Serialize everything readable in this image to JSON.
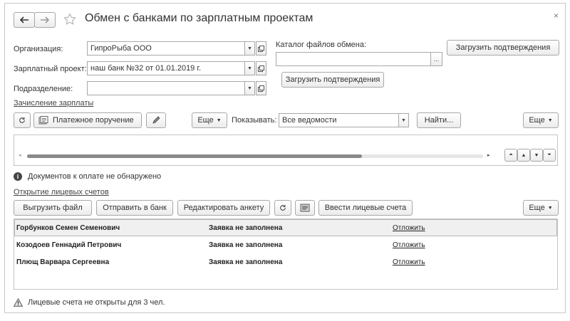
{
  "window": {
    "title": "Обмен с банками по зарплатным проектам",
    "close_glyph": "×"
  },
  "form": {
    "org_label": "Организация:",
    "org_value": "ГипроРыба ООО",
    "project_label": "Зарплатный проект:",
    "project_value": "наш банк №32 от 01.01.2019 г.",
    "division_label": "Подразделение:",
    "division_value": "",
    "catalog_label": "Каталог файлов обмена:",
    "catalog_value": "",
    "catalog_browse": "...",
    "load_confirm_top": "Загрузить подтверждения",
    "load_confirm_mid": "Загрузить подтверждения"
  },
  "salary": {
    "section_link": "Зачисление зарплаты",
    "payment_order_button": "Платежное поручение",
    "more_button": "Еще",
    "show_label": "Показывать:",
    "show_value": "Все ведомости",
    "find_button": "Найти...",
    "more_button_right": "Еще",
    "info_text": "Документов к оплате не обнаружено"
  },
  "accounts": {
    "section_link": "Открытие лицевых счетов",
    "export_button": "Выгрузить файл",
    "send_button": "Отправить в банк",
    "edit_button": "Редактировать анкету",
    "enter_button": "Ввести лицевые счета",
    "more_button": "Еще",
    "rows": [
      {
        "name": "Горбунков Семен Семенович",
        "status": "Заявка не заполнена",
        "action": "Отложить"
      },
      {
        "name": "Козодоев Геннадий Петрович",
        "status": "Заявка не заполнена",
        "action": "Отложить"
      },
      {
        "name": "Плющ Варвара Сергеевна",
        "status": "Заявка не заполнена",
        "action": "Отложить"
      }
    ],
    "warning_text": "Лицевые счета не открыты для 3 чел."
  },
  "icons": {
    "back": "arrow-left-icon",
    "forward": "arrow-right-icon",
    "favorite": "star-icon",
    "refresh": "refresh-icon",
    "edit": "pencil-icon",
    "info": "info-icon",
    "warning": "warning-icon"
  }
}
